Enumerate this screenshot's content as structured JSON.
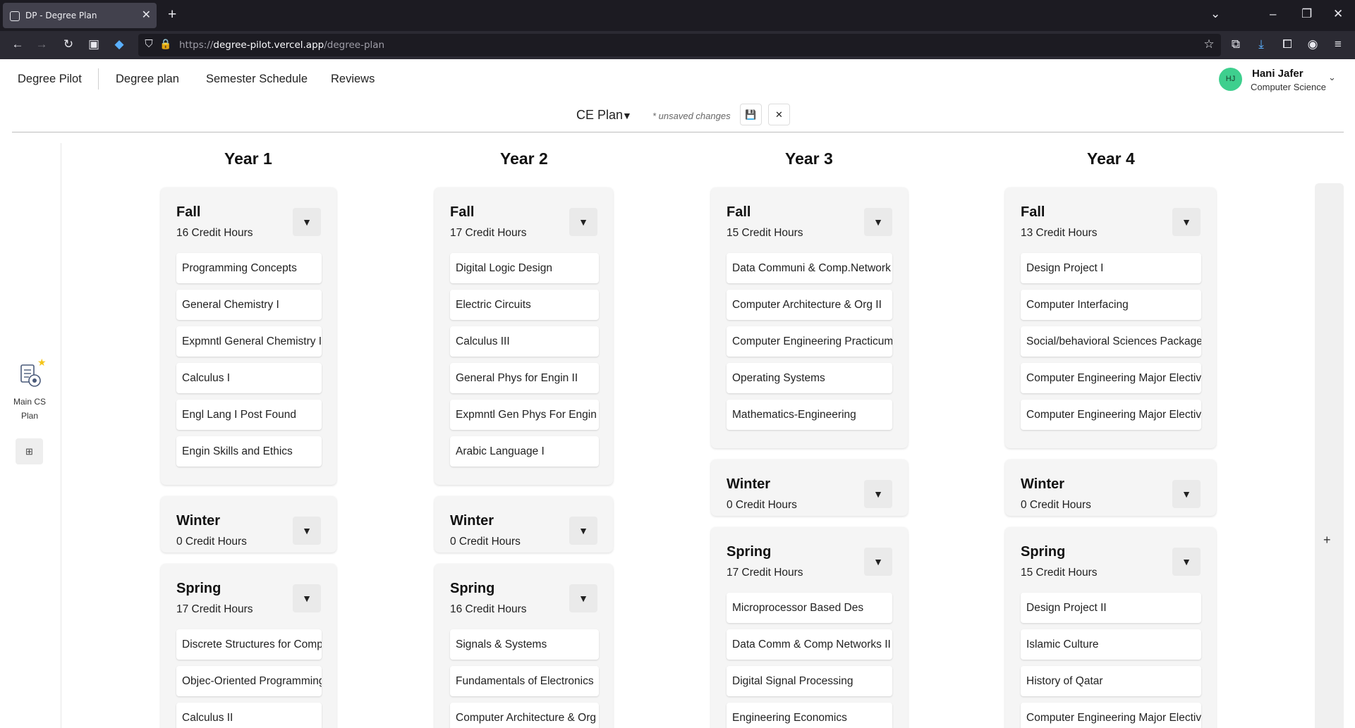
{
  "browser": {
    "tab_title": "DP - Degree Plan",
    "url_host_prefix": "https://",
    "url_host": "degree-pilot.vercel.app",
    "url_path": "/degree-plan"
  },
  "app": {
    "brand": "Degree Pilot",
    "nav": [
      "Degree plan",
      "Semester Schedule",
      "Reviews"
    ],
    "user": {
      "initials": "HJ",
      "name": "Hani Jafer",
      "major": "Computer Science"
    },
    "plan_name": "CE Plan",
    "unsaved": "* unsaved changes",
    "side_plan_label": "Main CS Plan"
  },
  "years": [
    {
      "title": "Year 1",
      "semesters": [
        {
          "name": "Fall",
          "hours": "16 Credit Hours",
          "courses": [
            "Programming Concepts",
            "General Chemistry I",
            "Expmntl General Chemistry I",
            "Calculus I",
            "Engl Lang I Post Found",
            "Engin Skills and Ethics"
          ]
        },
        {
          "name": "Winter",
          "hours": "0 Credit Hours",
          "courses": []
        },
        {
          "name": "Spring",
          "hours": "17 Credit Hours",
          "courses": [
            "Discrete Structures for Compt",
            "Objec-Oriented Programming",
            "Calculus II"
          ]
        }
      ]
    },
    {
      "title": "Year 2",
      "semesters": [
        {
          "name": "Fall",
          "hours": "17 Credit Hours",
          "courses": [
            "Digital Logic Design",
            "Electric Circuits",
            "Calculus III",
            "General Phys for Engin II",
            "Expmntl Gen Phys For Engin II",
            "Arabic Language I"
          ]
        },
        {
          "name": "Winter",
          "hours": "0 Credit Hours",
          "courses": []
        },
        {
          "name": "Spring",
          "hours": "16 Credit Hours",
          "courses": [
            "Signals & Systems",
            "Fundamentals of Electronics",
            "Computer Architecture & Org I"
          ]
        }
      ]
    },
    {
      "title": "Year 3",
      "semesters": [
        {
          "name": "Fall",
          "hours": "15 Credit Hours",
          "courses": [
            "Data Communi & Comp.Network I",
            "Computer Architecture & Org II",
            "Computer Engineering Practicum",
            "Operating Systems",
            "Mathematics-Engineering"
          ]
        },
        {
          "name": "Winter",
          "hours": "0 Credit Hours",
          "courses": []
        },
        {
          "name": "Spring",
          "hours": "17 Credit Hours",
          "courses": [
            "Microprocessor Based Des",
            "Data Comm & Comp Networks II",
            "Digital Signal Processing",
            "Engineering Economics"
          ]
        }
      ]
    },
    {
      "title": "Year 4",
      "semesters": [
        {
          "name": "Fall",
          "hours": "13 Credit Hours",
          "courses": [
            "Design Project I",
            "Computer Interfacing",
            "Social/behavioral Sciences Package",
            "Computer Engineering Major Electives",
            "Computer Engineering Major Electives"
          ]
        },
        {
          "name": "Winter",
          "hours": "0 Credit Hours",
          "courses": []
        },
        {
          "name": "Spring",
          "hours": "15 Credit Hours",
          "courses": [
            "Design Project II",
            "Islamic Culture",
            "History of Qatar",
            "Computer Engineering Major Electives"
          ]
        }
      ]
    }
  ]
}
